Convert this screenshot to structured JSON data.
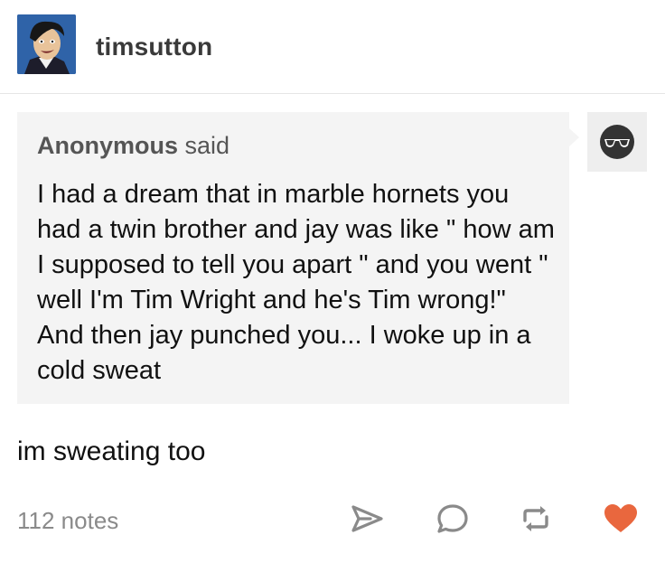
{
  "post": {
    "username": "timsutton",
    "ask": {
      "asker_name": "Anonymous",
      "said_label": "said",
      "question": "I had a dream that in marble hornets you had a twin brother and jay was like \" how am I supposed to tell you apart \" and you went \" well I'm Tim Wright and he's Tim wrong!\" And then jay punched you... I woke up in a cold sweat"
    },
    "answer": "im sweating too",
    "notes": "112 notes"
  },
  "icons": {
    "share": "share-icon",
    "reply": "reply-icon",
    "reblog": "reblog-icon",
    "like": "heart-icon"
  },
  "colors": {
    "ask_bg": "#f4f4f4",
    "like": "#e9673e",
    "icon_gray": "#8a8a8a",
    "avatar_bg": "#2f63a8"
  }
}
